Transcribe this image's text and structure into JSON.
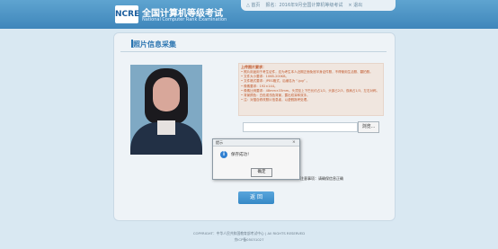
{
  "header": {
    "logo_text": "NCRE",
    "title_cn": "全国计算机等级考试",
    "title_en": "National Computer Rank Examination",
    "links": [
      "△ 首页",
      "报名：2016年9月全国计算机等级考试",
      "× 退出"
    ]
  },
  "section": {
    "title": "照片信息采集"
  },
  "requirements": {
    "title": "上传照片要求：",
    "items": [
      "• 照片用途用于考生证件，应为考生本人近期正面免冠半身证件照，不得使用生活照、翻拍照。",
      "• 文件大小要求：10KB-200KB。",
      "• 文件格式要求：JPEG格式，后缀名为 “.jpg” 。",
      "• 像素要求：192×144。",
      "• 像素比例要求：48mm×33mm。头顶至上下巴长约占1/2，头部占2/3，双肩占1/3，左右对称。",
      "• 背景颜色：白色或浅色背景，露出双耳和双手。",
      "• 注：对擅自修改照片信息者，以虚假报考处理。"
    ]
  },
  "upload": {
    "browse_label": "浏览..."
  },
  "note": "注意事项：请确保信息正确",
  "return_label": "返 回",
  "footer": {
    "line1": "COPYRIGHT：中华人民共和国教育部考试中心 | All RIGHTS RESERVED",
    "line2": "京ICP备05031027"
  },
  "dialog": {
    "title": "提示",
    "close": "×",
    "message": "保存成功！",
    "ok_label": "确定",
    "icon": "info-icon"
  },
  "colors": {
    "header": "#4a91c4",
    "accent": "#2a74b0",
    "warning_text": "#c0582c"
  }
}
